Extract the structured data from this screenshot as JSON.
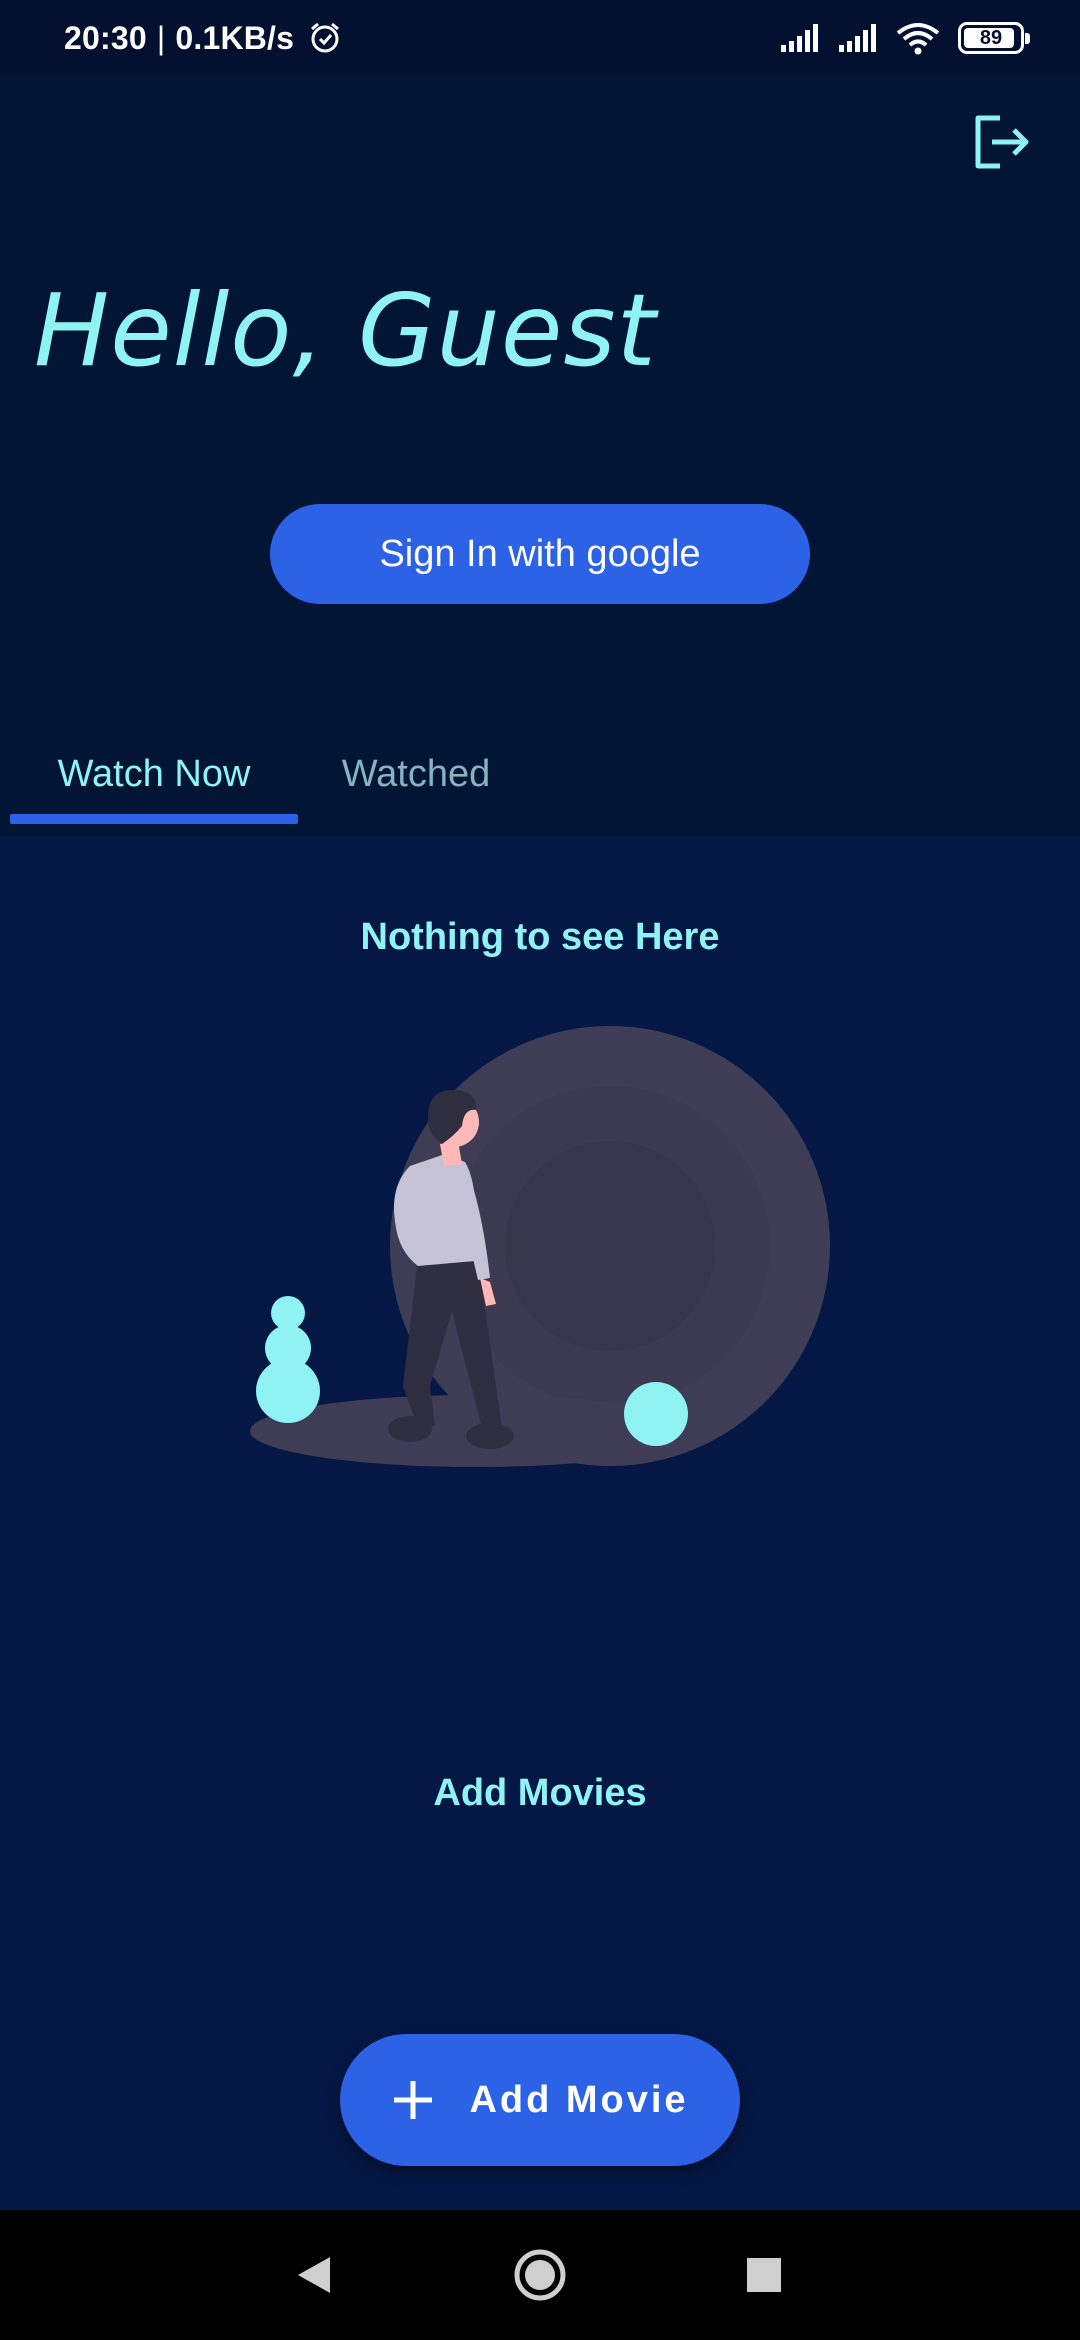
{
  "status_bar": {
    "time": "20:30",
    "separator": "|",
    "network_speed": "0.1KB/s",
    "battery_level": "89",
    "icons": [
      "alarm-icon",
      "signal-icon",
      "signal-icon",
      "wifi-icon",
      "battery-icon"
    ]
  },
  "header": {
    "logout_icon": "logout-icon",
    "greeting": "Hello, Guest",
    "signin_label": "Sign In with google"
  },
  "tabs": [
    {
      "label": "Watch Now",
      "active": true
    },
    {
      "label": "Watched",
      "active": false
    }
  ],
  "main": {
    "empty_title": "Nothing to see Here",
    "add_movies_label": "Add Movies",
    "illustration_icon": "empty-state-illustration"
  },
  "fab": {
    "icon": "plus-icon",
    "label": "Add Movie"
  },
  "nav_bar": {
    "icons": [
      "back-icon",
      "home-icon",
      "recents-icon"
    ]
  },
  "colors": {
    "background": "#051534",
    "content_background": "#051845",
    "accent": "#2b62e6",
    "cyan_text": "#8ff3f3",
    "inactive_tab": "#87b3c3"
  }
}
